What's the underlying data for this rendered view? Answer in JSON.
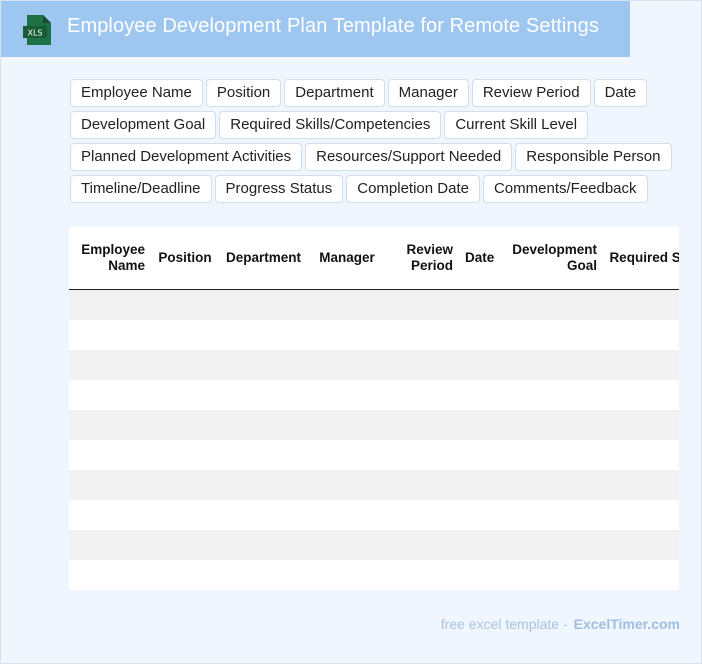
{
  "header": {
    "title": "Employee Development Plan Template for Remote Settings",
    "icon_label": "XLS",
    "icon_name": "excel-file-icon",
    "icon_color": "#1e7145"
  },
  "fields": [
    "Employee Name",
    "Position",
    "Department",
    "Manager",
    "Review Period",
    "Date",
    "Development Goal",
    "Required Skills/Competencies",
    "Current Skill Level",
    "Planned Development Activities",
    "Resources/Support Needed",
    "Responsible Person",
    "Timeline/Deadline",
    "Progress Status",
    "Completion Date",
    "Comments/Feedback"
  ],
  "table": {
    "headers": [
      "Employee Name",
      "Position",
      "Department",
      "Manager",
      "Review Period",
      "Date",
      "Development Goal",
      "Required Skills/Competencies"
    ],
    "empty_rows": 10
  },
  "footer": {
    "text": "free excel template -",
    "brand": "ExcelTimer.com"
  },
  "colors": {
    "header_bg": "#9dc6f1",
    "page_bg": "#f0f6fd",
    "row_stripe": "#f2f2f2"
  }
}
